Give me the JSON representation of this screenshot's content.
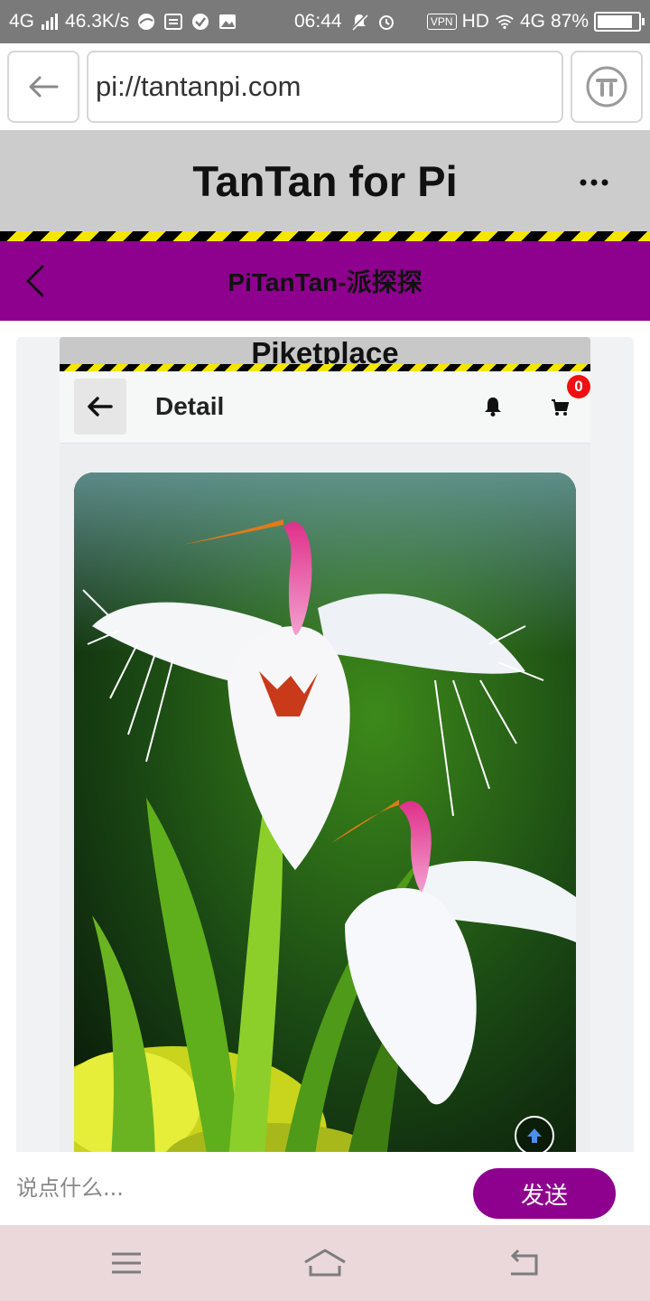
{
  "status_bar": {
    "network_left": "4G",
    "speed": "46.3K/s",
    "time": "06:44",
    "vpn": "VPN",
    "hd": "HD",
    "network_right": "4G",
    "battery": "87%",
    "battery_level": 0.87
  },
  "browser": {
    "url": "pi://tantanpi.com"
  },
  "app": {
    "title": "TanTan for Pi"
  },
  "nav": {
    "title": "PiTanTan-派探探"
  },
  "embed": {
    "title": "Piketplace",
    "detail_title": "Detail",
    "cart_count": "0"
  },
  "comment": {
    "placeholder": "说点什么...",
    "send_label": "发送"
  },
  "icons": {
    "browser_back": "arrow-left-icon",
    "pi_logo": "pi-logo-icon",
    "more": "more-dots-icon",
    "nav_back": "chevron-left-icon",
    "detail_back": "arrow-left-icon",
    "bell": "bell-icon",
    "cart": "cart-icon",
    "scroll_top": "arrow-up-icon",
    "menu": "menu-icon",
    "home": "home-icon",
    "back": "back-icon"
  },
  "colors": {
    "brand_purple": "#8e008e",
    "header_gray": "#cccccc",
    "hazard_yellow": "#f5e600",
    "badge_red": "#ee1111"
  }
}
